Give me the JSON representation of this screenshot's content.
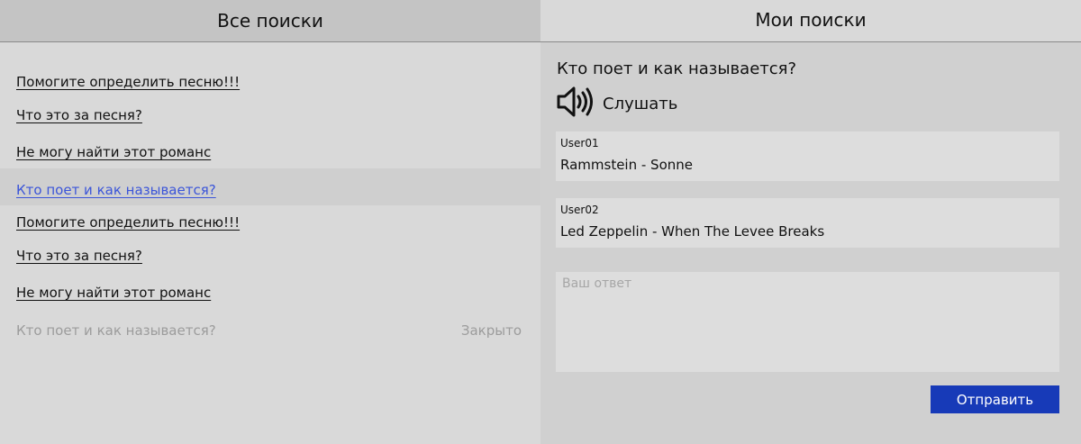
{
  "tabs": {
    "all": "Все поиски",
    "mine": "Мои поиски"
  },
  "searches": [
    {
      "title": "Помогите определить песню!!!",
      "state": "open"
    },
    {
      "title": "Что это за песня?",
      "state": "open"
    },
    {
      "title": "Не могу найти этот романс",
      "state": "open"
    },
    {
      "title": "Кто поет и как называется?",
      "state": "selected"
    },
    {
      "title": "Помогите определить песню!!!",
      "state": "open"
    },
    {
      "title": "Что это за песня?",
      "state": "open"
    },
    {
      "title": "Не могу найти этот романс",
      "state": "open"
    },
    {
      "title": "Кто поет и как называется?",
      "state": "closed",
      "status": "Закрыто"
    }
  ],
  "detail": {
    "question": "Кто поет и как называется?",
    "listen_label": "Слушать",
    "listen_icon": "speaker-icon",
    "answers": [
      {
        "user": "User01",
        "text": "Rammstein - Sonne"
      },
      {
        "user": "User02",
        "text": "Led Zeppelin - When The Levee Breaks"
      }
    ],
    "reply_placeholder": "Ваш ответ",
    "send_label": "Отправить"
  },
  "colors": {
    "accent": "#173ab8",
    "selected_link": "#3b55d9",
    "muted": "#9c9c9c"
  }
}
